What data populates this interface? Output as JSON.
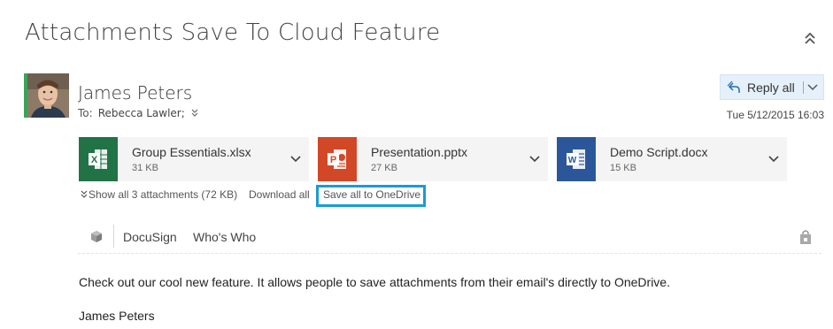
{
  "email": {
    "subject": "Attachments Save To Cloud Feature",
    "sender": "James Peters",
    "to_label": "To:",
    "to_recipient": "Rebecca Lawler;",
    "date": "Tue 5/12/2015 16:03",
    "body": "Check out our cool new feature. It allows people to save attachments from their email's directly to OneDrive.",
    "signature": "James Peters"
  },
  "reply": {
    "label": "Reply all"
  },
  "attachments": [
    {
      "name": "Group Essentials.xlsx",
      "size": "31 KB",
      "type": "excel",
      "icon_color": "#217346",
      "letter": "X"
    },
    {
      "name": "Presentation.pptx",
      "size": "27 KB",
      "type": "powerpoint",
      "icon_color": "#d24726",
      "letter": "P"
    },
    {
      "name": "Demo Script.docx",
      "size": "15 KB",
      "type": "word",
      "icon_color": "#2b579a",
      "letter": "W"
    }
  ],
  "attachment_actions": {
    "show_all": "Show all 3 attachments (72 KB)",
    "download_all": "Download all",
    "save_all": "Save all to OneDrive"
  },
  "addins": {
    "items": [
      "DocuSign",
      "Who's Who"
    ]
  },
  "colors": {
    "highlight_border": "#1a9bd7",
    "avatar_accent": "#3aa35a",
    "reply_background": "#e6f0fa"
  }
}
